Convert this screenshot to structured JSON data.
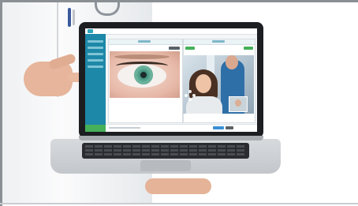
{
  "scene": {
    "description_visible_text": "",
    "colors": {
      "accent": "#1e88a8",
      "green": "#46b05a",
      "blue_button": "#3a8fd6",
      "laptop_dark": "#1c1e21",
      "laptop_silver": "#c3c7cb",
      "skin": "#e6b59b"
    },
    "icons": [
      "stethoscope-icon",
      "pen-icon"
    ]
  }
}
